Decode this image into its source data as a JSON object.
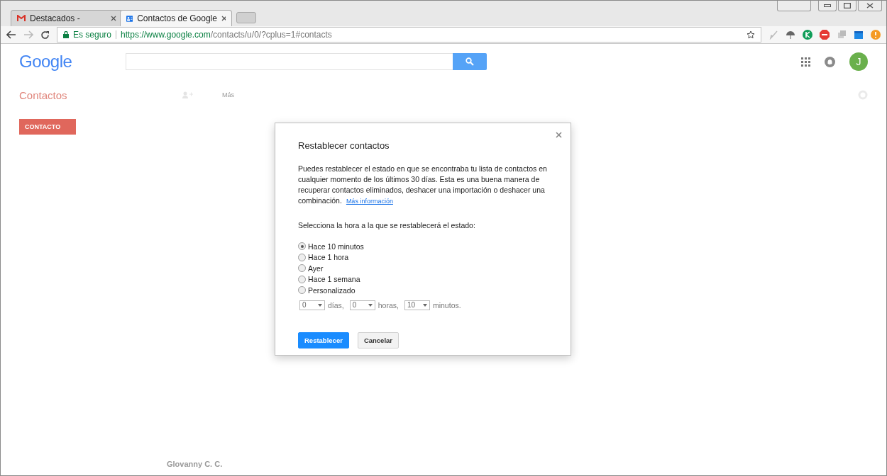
{
  "browser": {
    "tabs": [
      {
        "title": "Destacados -",
        "kind": "mail",
        "selected": false
      },
      {
        "title": "Contactos de Google",
        "kind": "contacts",
        "selected": true
      }
    ],
    "security": "Es seguro",
    "url_host": "https://www.google.com",
    "url_path": "/contacts/u/0/?cplus=1#contacts"
  },
  "header": {
    "logo": "Google",
    "avatar": "J"
  },
  "background": {
    "title": "Contactos",
    "more": "Más",
    "new_button": "CONTACTO",
    "rows": [
      "Glovanny C. C."
    ]
  },
  "dialog": {
    "title": "Restablecer contactos",
    "description": "Puedes restablecer el estado en que se encontraba tu lista de contactos en cualquier momento de los últimos 30 días. Esta es una buena manera de recuperar contactos eliminados, deshacer una importación o deshacer una combinación.",
    "link": "Más información",
    "prompt": "Selecciona la hora a la que se restablecerá el estado:",
    "options": [
      {
        "label": "Hace 10 minutos",
        "selected": true
      },
      {
        "label": "Hace 1 hora",
        "selected": false
      },
      {
        "label": "Ayer",
        "selected": false
      },
      {
        "label": "Hace 1 semana",
        "selected": false
      },
      {
        "label": "Personalizado",
        "selected": false
      }
    ],
    "custom": [
      {
        "value": "0",
        "unit": "días,"
      },
      {
        "value": "0",
        "unit": "horas,"
      },
      {
        "value": "10",
        "unit": "minutos."
      }
    ],
    "buttons": [
      {
        "label": "Restablecer",
        "kind": "primary"
      },
      {
        "label": "Cancelar",
        "kind": "secondary"
      }
    ]
  }
}
